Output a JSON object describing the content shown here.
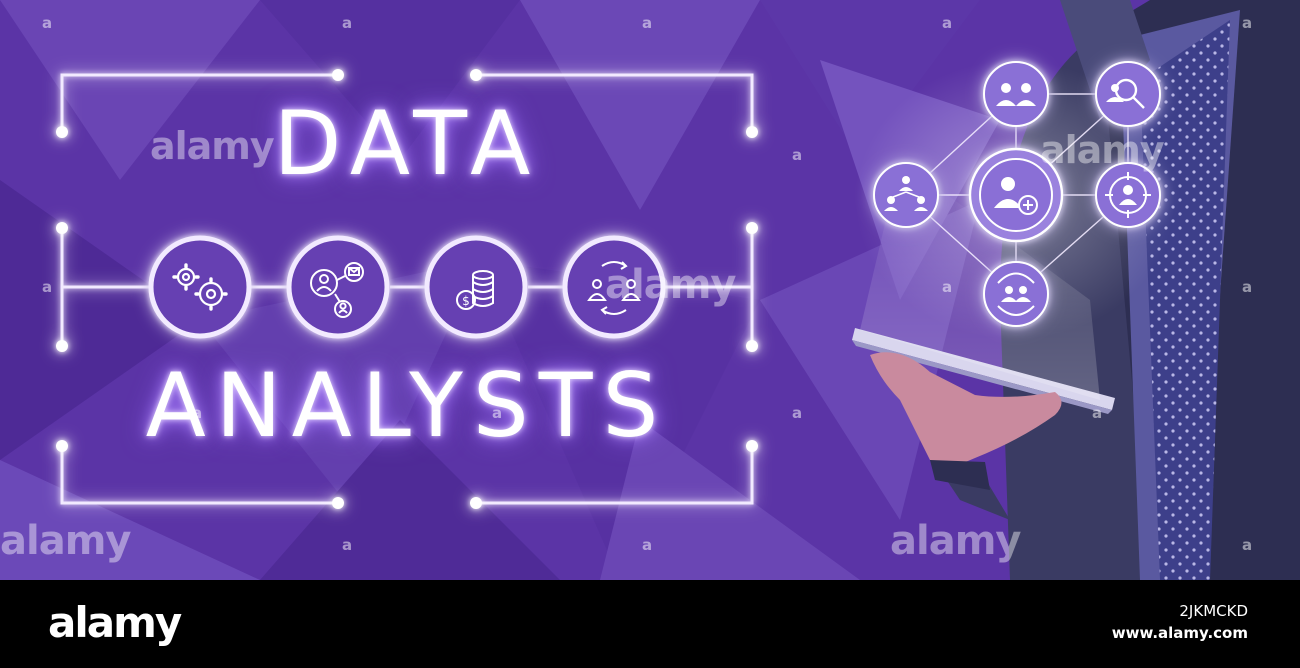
{
  "headline": {
    "line1": "DATA",
    "line2": "ANALYSTS"
  },
  "process_icons": [
    {
      "name": "gears-icon"
    },
    {
      "name": "people-network-icon"
    },
    {
      "name": "coin-stack-icon"
    },
    {
      "name": "people-exchange-icon"
    }
  ],
  "network_icons": [
    {
      "name": "group-icon"
    },
    {
      "name": "user-search-icon"
    },
    {
      "name": "team-hierarchy-icon"
    },
    {
      "name": "add-user-icon"
    },
    {
      "name": "user-target-icon"
    },
    {
      "name": "group-refresh-icon"
    }
  ],
  "watermark": {
    "brand": "alamy",
    "glyph": "a"
  },
  "footer": {
    "brand": "alamy",
    "image_id": "2JKMCKD",
    "url": "www.alamy.com"
  },
  "colors": {
    "background": "#5b34a6",
    "glow": "#f2eaff",
    "footer": "#000000"
  }
}
